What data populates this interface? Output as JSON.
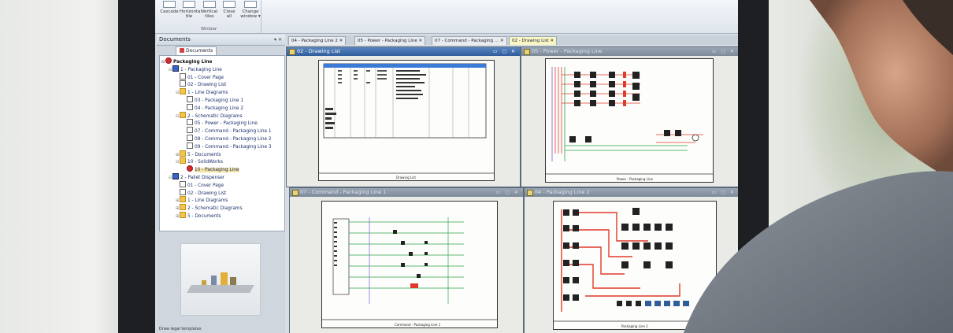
{
  "ribbon": {
    "buttons": [
      {
        "line1": "Cascade",
        "line2": ""
      },
      {
        "line1": "Horizontal",
        "line2": "tile"
      },
      {
        "line1": "Vertical",
        "line2": "tiles"
      },
      {
        "line1": "Close",
        "line2": "all"
      },
      {
        "line1": "Change",
        "line2": "window ▾"
      }
    ],
    "group_label": "Window"
  },
  "documents_panel": {
    "title": "Documents",
    "title_controls": "▾ ✕",
    "tab": "Documents",
    "tree": [
      {
        "label": "Packaging Line",
        "level": 0,
        "icon": "sw",
        "toggle": "⊟",
        "bold": true
      },
      {
        "label": "1 - Packaging Line",
        "level": 1,
        "icon": "prj",
        "toggle": "⊟"
      },
      {
        "label": "01 - Cover Page",
        "level": 2,
        "icon": "page",
        "toggle": ""
      },
      {
        "label": "02 - Drawing List",
        "level": 2,
        "icon": "page",
        "toggle": ""
      },
      {
        "label": "1 - Line Diagrams",
        "level": 2,
        "icon": "folder",
        "toggle": "⊟"
      },
      {
        "label": "03 - Packaging Line 1",
        "level": 3,
        "icon": "page",
        "toggle": ""
      },
      {
        "label": "04 - Packaging Line 2",
        "level": 3,
        "icon": "page",
        "toggle": ""
      },
      {
        "label": "2 - Schematic Diagrams",
        "level": 2,
        "icon": "folder",
        "toggle": "⊟"
      },
      {
        "label": "05 - Power - Packaging Line",
        "level": 3,
        "icon": "page",
        "toggle": ""
      },
      {
        "label": "07 - Command - Packaging Line 1",
        "level": 3,
        "icon": "page",
        "toggle": ""
      },
      {
        "label": "08 - Command - Packaging Line 2",
        "level": 3,
        "icon": "page",
        "toggle": ""
      },
      {
        "label": "09 - Command - Packaging Line 3",
        "level": 3,
        "icon": "page",
        "toggle": ""
      },
      {
        "label": "5 - Documents",
        "level": 2,
        "icon": "folder",
        "toggle": "⊞"
      },
      {
        "label": "10 - SolidWorks",
        "level": 2,
        "icon": "folder",
        "toggle": "⊟"
      },
      {
        "label": "10 - Packaging Line",
        "level": 3,
        "icon": "sw",
        "toggle": "",
        "selected": true
      },
      {
        "label": "2 - Pallet Dispenser",
        "level": 1,
        "icon": "prj",
        "toggle": "⊟"
      },
      {
        "label": "01 - Cover Page",
        "level": 2,
        "icon": "page",
        "toggle": ""
      },
      {
        "label": "02 - Drawing List",
        "level": 2,
        "icon": "page",
        "toggle": ""
      },
      {
        "label": "1 - Line Diagrams",
        "level": 2,
        "icon": "folder",
        "toggle": "⊞"
      },
      {
        "label": "2 - Schematic Diagrams",
        "level": 2,
        "icon": "folder",
        "toggle": "⊞"
      },
      {
        "label": "5 - Documents",
        "level": 2,
        "icon": "folder",
        "toggle": "⊞"
      }
    ],
    "status_text": "Draw legal templates"
  },
  "mdi_tabs": [
    {
      "label": "04 - Packaging Line 2 ✕"
    },
    {
      "label": "05 - Power - Packaging Line ✕"
    },
    {
      "label": "07 - Command - Packaging ... ✕"
    },
    {
      "label": "02 - Drawing List ✕"
    }
  ],
  "windows": [
    {
      "title": "02 - Drawing List",
      "controls": "▭ ▢ ✕",
      "sheet_label": "Drawing List"
    },
    {
      "title": "05 - Power - Packaging Line",
      "controls": "▭ ▢ ✕",
      "sheet_label": "Power - Packaging Line"
    },
    {
      "title": "07 - Command - Packaging Line 1",
      "controls": "▭ ▢ ✕",
      "sheet_label": "Command - Packaging Line 1"
    },
    {
      "title": "04 - Packaging Line 2",
      "controls": "▭ ▢ ✕",
      "sheet_label": "Packaging Line 2"
    }
  ],
  "colors": {
    "accent_blue": "#2f5d9c",
    "wire_red": "#e23a2a",
    "wire_green": "#2aa34a",
    "wire_purple": "#7a5bd0"
  }
}
